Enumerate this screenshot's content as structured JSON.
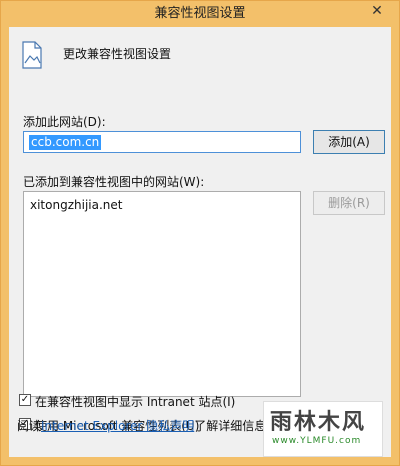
{
  "window": {
    "title": "兼容性视图设置",
    "close_glyph": "✕"
  },
  "header": {
    "heading": "更改兼容性视图设置",
    "icon": "document-image-icon"
  },
  "add_site": {
    "label": "添加此网站(D):",
    "value": "ccb.com.cn",
    "add_button": "添加(A)"
  },
  "site_list": {
    "label": "已添加到兼容性视图中的网站(W):",
    "items": [
      "xitongzhijia.net"
    ],
    "remove_button": "删除(R)"
  },
  "options": {
    "intranet": {
      "label": "在兼容性视图中显示 Intranet 站点(I)",
      "checked": true
    },
    "ms_list": {
      "label": "使用 Microsoft 兼容性列表(U)",
      "checked": true
    }
  },
  "footer": {
    "prefix": "阅读",
    "link": "Internet Explorer 隐私声明",
    "suffix": "了解详细信息"
  },
  "watermark": {
    "logo": "雨林木风",
    "url": "www.YLMFU.com"
  },
  "colors": {
    "titlebar": "#f3c06a",
    "client": "#f0f0f0",
    "link": "#1a5fb4",
    "selection": "#3399ff"
  }
}
